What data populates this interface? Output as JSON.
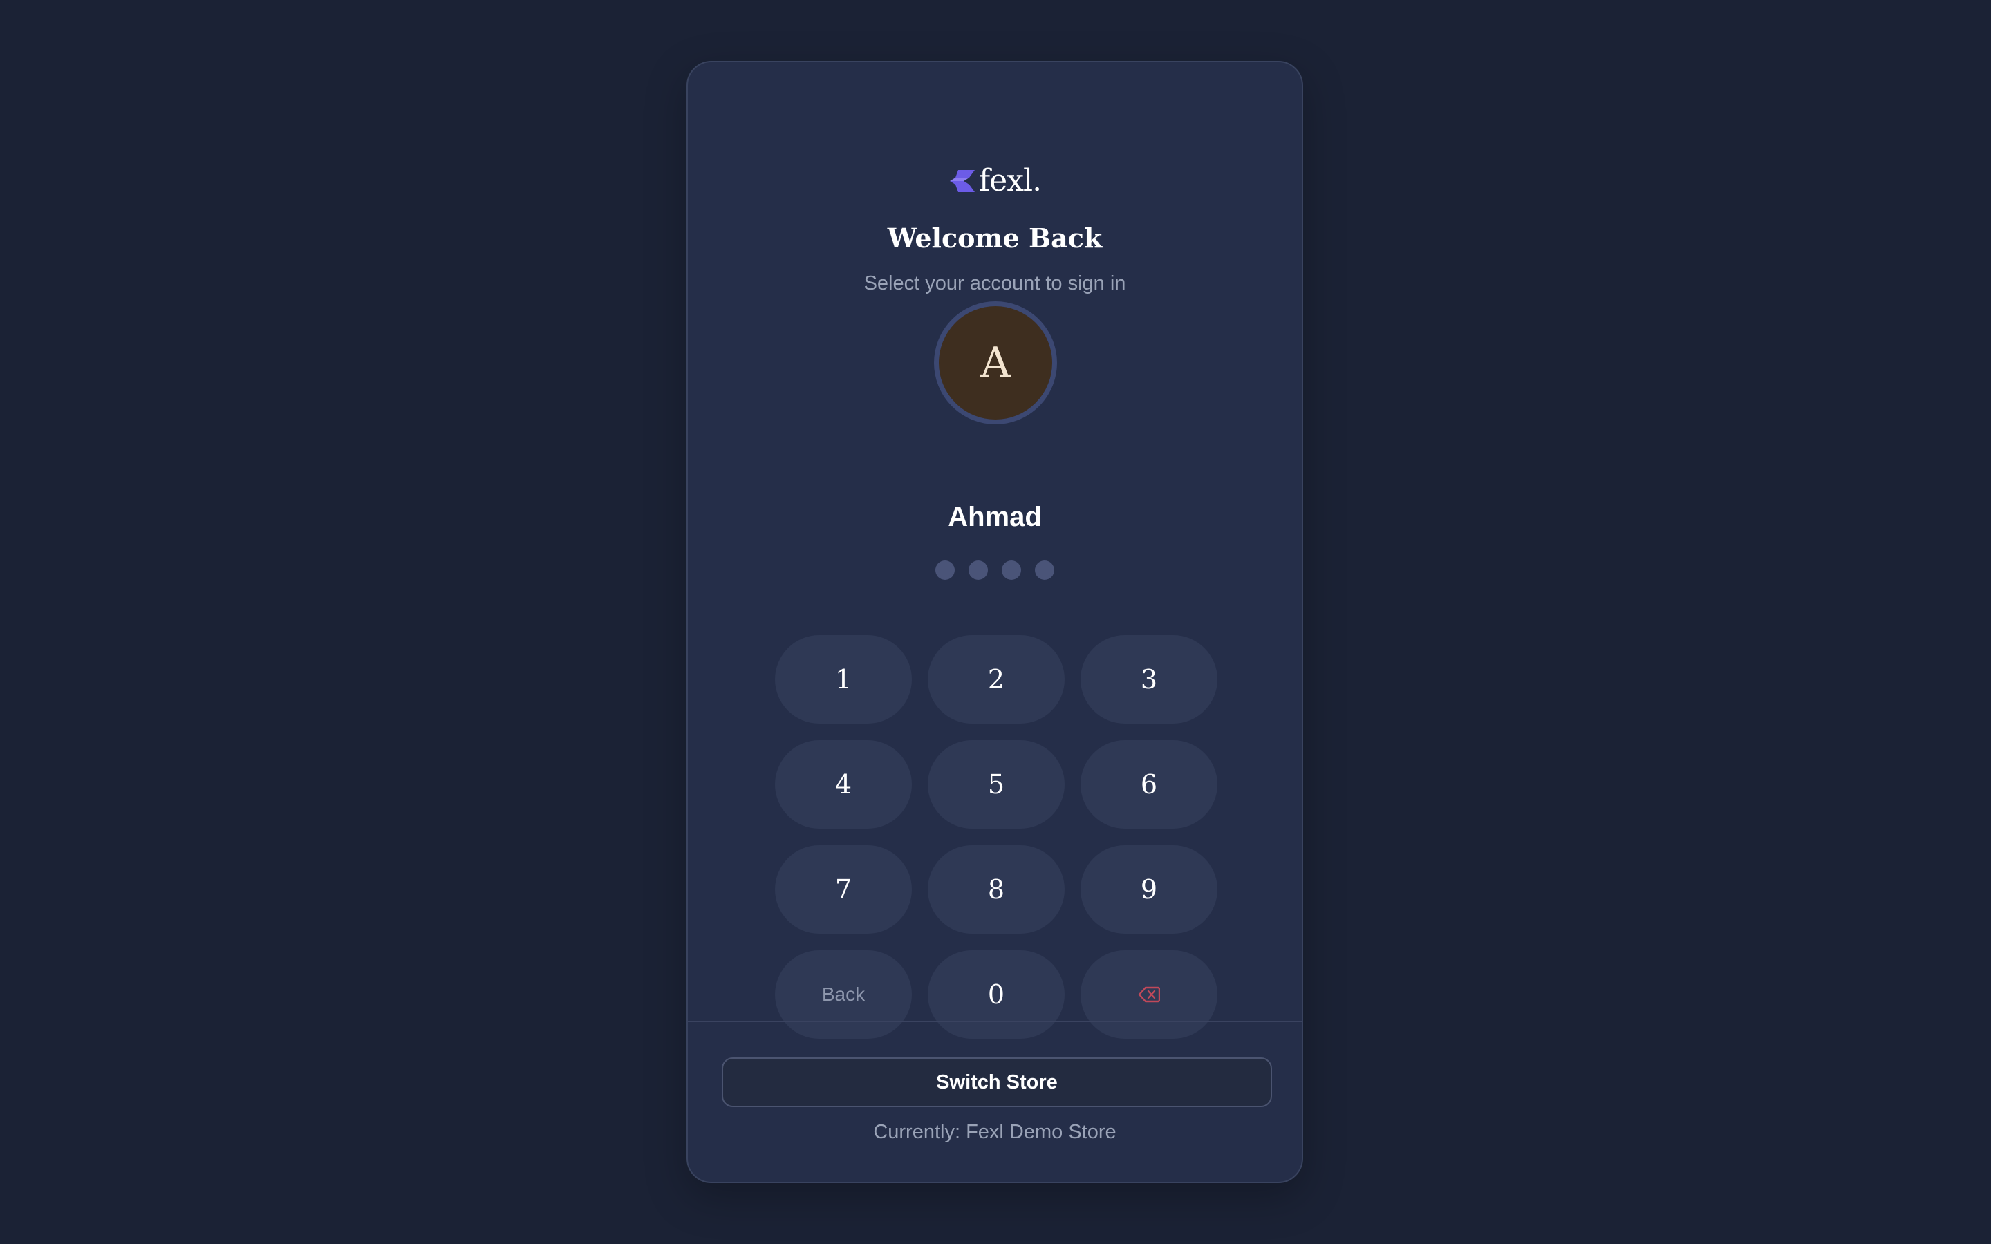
{
  "brand": {
    "name": "fexl.",
    "accent_color": "#6c5ce7"
  },
  "header": {
    "title": "Welcome Back",
    "subtitle": "Select your account to sign in"
  },
  "user": {
    "initial": "A",
    "name": "Ahmad",
    "avatar_color": "#3e2e1f"
  },
  "pin": {
    "length": 4,
    "entered": 0
  },
  "keypad": {
    "keys": [
      "1",
      "2",
      "3",
      "4",
      "5",
      "6",
      "7",
      "8",
      "9"
    ],
    "back_label": "Back",
    "zero": "0",
    "delete_icon": "backspace-icon",
    "delete_color": "#c0495a"
  },
  "footer": {
    "switch_label": "Switch Store",
    "current_store": "Currently: Fexl Demo Store"
  }
}
